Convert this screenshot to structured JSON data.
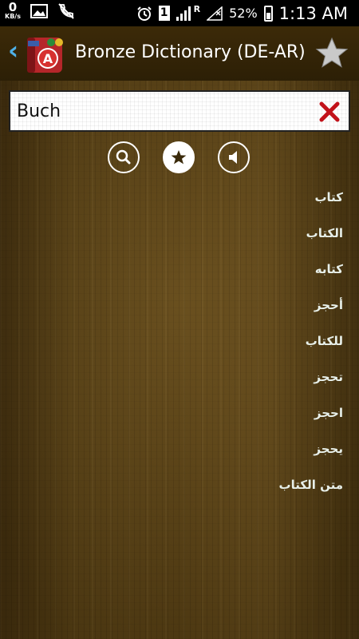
{
  "status_bar": {
    "kb_value": "0",
    "kb_unit": "KB/s",
    "network_type": "R",
    "sim_slot": "1",
    "battery_percent": "52%",
    "time": "1:13 AM"
  },
  "action_bar": {
    "back_icon": "chevron-left-icon",
    "title": "Bronze Dictionary (DE-AR)",
    "favorite_icon": "star-icon"
  },
  "search": {
    "value": "Buch",
    "clear_icon": "close-icon"
  },
  "tools": [
    {
      "icon": "search-icon",
      "active": false
    },
    {
      "icon": "star-icon",
      "active": true
    },
    {
      "icon": "speaker-icon",
      "active": false
    }
  ],
  "results": [
    "كتاب",
    "الكتاب",
    "كتابه",
    "أحجز",
    "للكتاب",
    "تحجز",
    "احجز",
    "يحجز",
    "متن الكتاب"
  ],
  "colors": {
    "accent_blue": "#4fb1e8",
    "clear_red": "#c2121a",
    "result_text": "#e7efe9"
  }
}
